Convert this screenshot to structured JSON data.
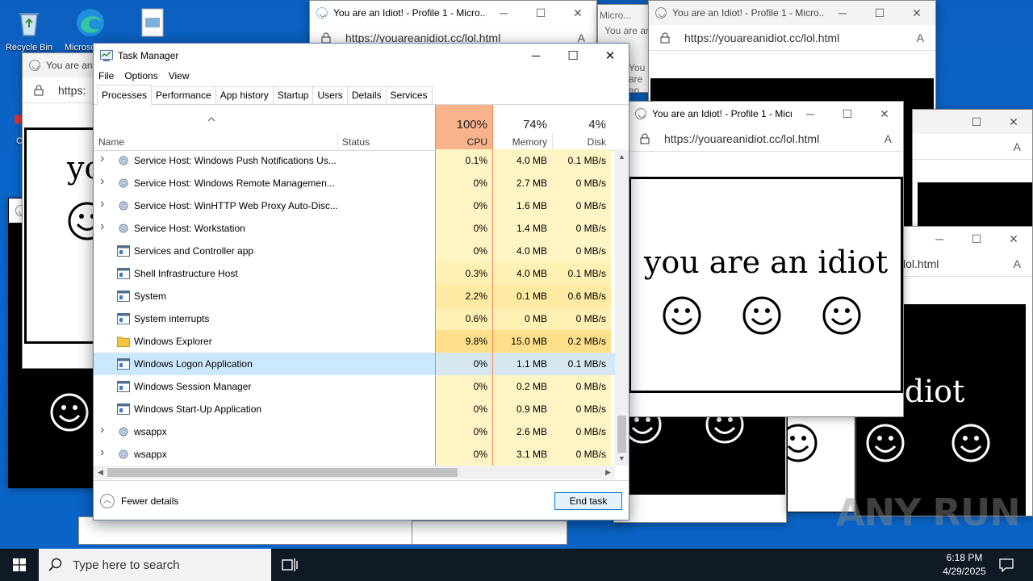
{
  "desktop": {
    "icons": [
      {
        "name": "recycle-bin",
        "label": "Recycle Bin"
      },
      {
        "name": "edge",
        "label": "Microsoft Edge"
      },
      {
        "name": "file",
        "label": ""
      },
      {
        "name": "ccleaner",
        "label": "CC"
      }
    ]
  },
  "browser": {
    "tab_title": "You are an Idiot! - Profile 1 - Micro...",
    "tab_title_short": "You are an",
    "tab_title_micro": "Micro...",
    "url": "https://youareanidiot.cc/lol.html",
    "url_fragment": "lol.html",
    "url_stub": "https:",
    "phrase": "you are an idiot",
    "phrase_partial": "yo",
    "phrase_tail": "n idiot",
    "phrase_tail2": "you",
    "reader_label": "A",
    "minimize": "─",
    "maximize": "☐",
    "close": "✕"
  },
  "task_manager": {
    "title": "Task Manager",
    "controls": {
      "minimize": "─",
      "maximize": "☐",
      "close": "✕"
    },
    "menu": [
      "File",
      "Options",
      "View"
    ],
    "tabs": [
      "Processes",
      "Performance",
      "App history",
      "Startup",
      "Users",
      "Details",
      "Services"
    ],
    "active_tab": "Processes",
    "columns": {
      "name": "Name",
      "status": "Status",
      "cpu": {
        "label": "CPU",
        "total": "100%"
      },
      "memory": {
        "label": "Memory",
        "total": "74%"
      },
      "disk": {
        "label": "Disk",
        "total": "4%"
      }
    },
    "processes": [
      {
        "name": "Service Host: Windows Push Notifications Us...",
        "expandable": true,
        "icon": "gear-icon",
        "status": "",
        "cpu": "0.1%",
        "memory": "4.0 MB",
        "disk": "0.1 MB/s",
        "heat": "#fff4c4",
        "selected": false
      },
      {
        "name": "Service Host: Windows Remote Managemen...",
        "expandable": true,
        "icon": "gear-icon",
        "status": "",
        "cpu": "0%",
        "memory": "2.7 MB",
        "disk": "0 MB/s",
        "heat": "#fff4c4",
        "selected": false
      },
      {
        "name": "Service Host: WinHTTP Web Proxy Auto-Disc...",
        "expandable": true,
        "icon": "gear-icon",
        "status": "",
        "cpu": "0%",
        "memory": "1.6 MB",
        "disk": "0 MB/s",
        "heat": "#fff4c4",
        "selected": false
      },
      {
        "name": "Service Host: Workstation",
        "expandable": true,
        "icon": "gear-icon",
        "status": "",
        "cpu": "0%",
        "memory": "1.4 MB",
        "disk": "0 MB/s",
        "heat": "#fff4c4",
        "selected": false
      },
      {
        "name": "Services and Controller app",
        "expandable": false,
        "icon": "app-window-icon",
        "status": "",
        "cpu": "0%",
        "memory": "4.0 MB",
        "disk": "0 MB/s",
        "heat": "#fff4c4",
        "selected": false
      },
      {
        "name": "Shell Infrastructure Host",
        "expandable": false,
        "icon": "app-window-icon",
        "status": "",
        "cpu": "0.3%",
        "memory": "4.0 MB",
        "disk": "0.1 MB/s",
        "heat": "#fff0b4",
        "selected": false
      },
      {
        "name": "System",
        "expandable": false,
        "icon": "app-window-icon",
        "status": "",
        "cpu": "2.2%",
        "memory": "0.1 MB",
        "disk": "0.6 MB/s",
        "heat": "#ffeaa3",
        "selected": false
      },
      {
        "name": "System interrupts",
        "expandable": false,
        "icon": "app-window-icon",
        "status": "",
        "cpu": "0.6%",
        "memory": "0 MB",
        "disk": "0 MB/s",
        "heat": "#fff0b4",
        "selected": false
      },
      {
        "name": "Windows Explorer",
        "expandable": false,
        "icon": "folder-icon",
        "status": "",
        "cpu": "9.8%",
        "memory": "15.0 MB",
        "disk": "0.2 MB/s",
        "heat": "#ffe08a",
        "selected": false
      },
      {
        "name": "Windows Logon Application",
        "expandable": false,
        "icon": "app-window-icon",
        "status": "",
        "cpu": "0%",
        "memory": "1.1 MB",
        "disk": "0.1 MB/s",
        "heat": "#d6e6ef",
        "selected": true
      },
      {
        "name": "Windows Session Manager",
        "expandable": false,
        "icon": "app-window-icon",
        "status": "",
        "cpu": "0%",
        "memory": "0.2 MB",
        "disk": "0 MB/s",
        "heat": "#fff4c4",
        "selected": false
      },
      {
        "name": "Windows Start-Up Application",
        "expandable": false,
        "icon": "app-window-icon",
        "status": "",
        "cpu": "0%",
        "memory": "0.9 MB",
        "disk": "0 MB/s",
        "heat": "#fff4c4",
        "selected": false
      },
      {
        "name": "wsappx",
        "expandable": true,
        "icon": "gear-icon",
        "status": "",
        "cpu": "0%",
        "memory": "2.6 MB",
        "disk": "0 MB/s",
        "heat": "#fff4c4",
        "selected": false
      },
      {
        "name": "wsappx",
        "expandable": true,
        "icon": "gear-icon",
        "status": "",
        "cpu": "0%",
        "memory": "3.1 MB",
        "disk": "0 MB/s",
        "heat": "#fff4c4",
        "selected": false
      }
    ],
    "fewer_details": "Fewer details",
    "end_task": "End task",
    "colors": {
      "cpu_header": "#f9b38c",
      "cpu_border": "#f08a5d",
      "selection": "#cce8ff",
      "accent": "#0078d7"
    }
  },
  "taskbar": {
    "search_placeholder": "Type here to search",
    "time": "6:18 PM",
    "date": "4/29/2025"
  },
  "watermark": "ANY RUN"
}
